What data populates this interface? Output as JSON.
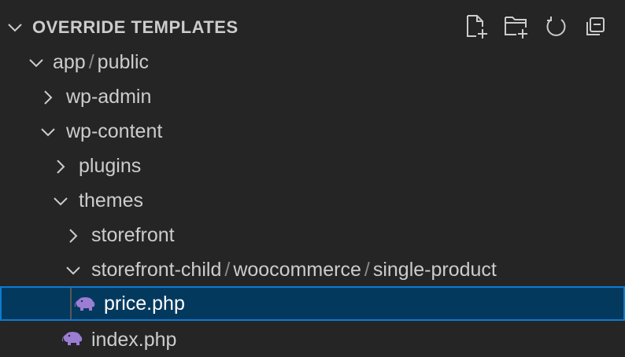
{
  "section": {
    "title": "OVERRIDE TEMPLATES",
    "actions": [
      {
        "name": "new-file-icon",
        "label": "New File"
      },
      {
        "name": "new-folder-icon",
        "label": "New Folder"
      },
      {
        "name": "refresh-icon",
        "label": "Refresh"
      },
      {
        "name": "collapse-all-icon",
        "label": "Collapse All"
      }
    ]
  },
  "tree": {
    "app_public": {
      "seg1": "app",
      "seg2": "public"
    },
    "wp_admin": "wp-admin",
    "wp_content": "wp-content",
    "plugins": "plugins",
    "themes": "themes",
    "storefront": "storefront",
    "storefront_child": {
      "seg1": "storefront-child",
      "seg2": "woocommerce",
      "seg3": "single-product"
    },
    "price_php": "price.php",
    "index_php": "index.php"
  },
  "colors": {
    "background": "#252526",
    "selection": "#04395e",
    "selection_border": "#0e7ad1",
    "php_icon": "#9b7dd4"
  }
}
